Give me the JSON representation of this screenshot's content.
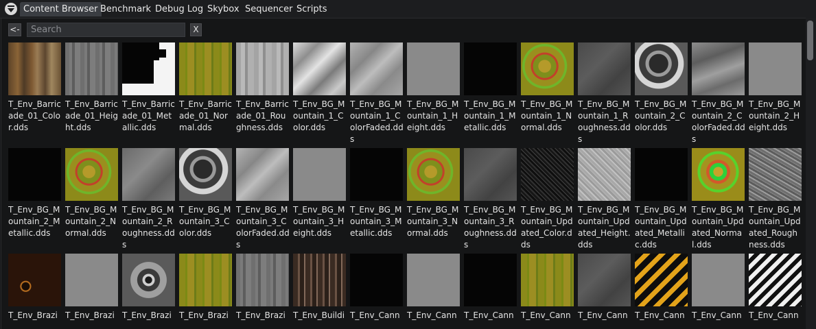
{
  "tabs": [
    {
      "label": "Content Browser",
      "active": true
    },
    {
      "label": "Benchmark",
      "active": false
    },
    {
      "label": "Debug Log",
      "active": false
    },
    {
      "label": "Skybox",
      "active": false
    },
    {
      "label": "Sequencer",
      "active": false
    },
    {
      "label": "Scripts",
      "active": false
    }
  ],
  "toolbar": {
    "back_label": "<-",
    "search_placeholder": "Search",
    "search_value": "",
    "clear_label": "X"
  },
  "icons": {
    "menu": "triangle-menu-icon"
  },
  "files": [
    {
      "label": "T_Env_Barricade_01_Color.dds",
      "thumb": "rust"
    },
    {
      "label": "T_Env_Barricade_01_Height.dds",
      "thumb": "graytex"
    },
    {
      "label": "T_Env_Barricade_01_Metallic.dds",
      "thumb": "bwmask"
    },
    {
      "label": "T_Env_Barricade_01_Normal.dds",
      "thumb": "normalflat"
    },
    {
      "label": "T_Env_Barricade_01_Roughness.dds",
      "thumb": "lightgray"
    },
    {
      "label": "T_Env_BG_Mountain_1_Color.dds",
      "thumb": "mountainlight"
    },
    {
      "label": "T_Env_BG_Mountain_1_ColorFaded.dds",
      "thumb": "mountainfaded"
    },
    {
      "label": "T_Env_BG_Mountain_1_Height.dds",
      "thumb": "flatgray"
    },
    {
      "label": "T_Env_BG_Mountain_1_Metallic.dds",
      "thumb": "black"
    },
    {
      "label": "T_Env_BG_Mountain_1_Normal.dds",
      "thumb": "normalmount"
    },
    {
      "label": "T_Env_BG_Mountain_1_Roughness.dds",
      "thumb": "darkgray"
    },
    {
      "label": "T_Env_BG_Mountain_2_Color.dds",
      "thumb": "mountaincontrast"
    },
    {
      "label": "T_Env_BG_Mountain_2_ColorFaded.dds",
      "thumb": "mountainfaded2"
    },
    {
      "label": "T_Env_BG_Mountain_2_Height.dds",
      "thumb": "flatgray"
    },
    {
      "label": "T_Env_BG_Mountain_2_Metallic.dds",
      "thumb": "black"
    },
    {
      "label": "T_Env_BG_Mountain_2_Normal.dds",
      "thumb": "normalmount"
    },
    {
      "label": "T_Env_BG_Mountain_2_Roughness.dds",
      "thumb": "midgray"
    },
    {
      "label": "T_Env_BG_Mountain_3_Color.dds",
      "thumb": "mountaincontrast"
    },
    {
      "label": "T_Env_BG_Mountain_3_ColorFaded.dds",
      "thumb": "mountainfaded"
    },
    {
      "label": "T_Env_BG_Mountain_3_Height.dds",
      "thumb": "flatgray"
    },
    {
      "label": "T_Env_BG_Mountain_3_Metallic.dds",
      "thumb": "black"
    },
    {
      "label": "T_Env_BG_Mountain_3_Normal.dds",
      "thumb": "normalmount"
    },
    {
      "label": "T_Env_BG_Mountain_3_Roughness.dds",
      "thumb": "darkgray"
    },
    {
      "label": "T_Env_BG_Mountain_Updated_Color.dds",
      "thumb": "darknoise"
    },
    {
      "label": "T_Env_BG_Mountain_Updated_Height.dds",
      "thumb": "lightnoise"
    },
    {
      "label": "T_Env_BG_Mountain_Updated_Metallic.dds",
      "thumb": "black"
    },
    {
      "label": "T_Env_BG_Mountain_Updated_Normal.dds",
      "thumb": "normalvivid"
    },
    {
      "label": "T_Env_BG_Mountain_Updated_Roughness.dds",
      "thumb": "graynoise"
    },
    {
      "label": "T_Env_Brazi",
      "thumb": "brazier"
    },
    {
      "label": "T_Env_Brazi",
      "thumb": "flatgray"
    },
    {
      "label": "T_Env_Brazi",
      "thumb": "gear"
    },
    {
      "label": "T_Env_Brazi",
      "thumb": "normalflat"
    },
    {
      "label": "T_Env_Brazi",
      "thumb": "graytex"
    },
    {
      "label": "T_Env_Buildi",
      "thumb": "wood"
    },
    {
      "label": "T_Env_Cann",
      "thumb": "black"
    },
    {
      "label": "T_Env_Cann",
      "thumb": "flatgray"
    },
    {
      "label": "T_Env_Cann",
      "thumb": "black"
    },
    {
      "label": "T_Env_Cann",
      "thumb": "normalflat"
    },
    {
      "label": "T_Env_Cann",
      "thumb": "darkgray"
    },
    {
      "label": "T_Env_Cann",
      "thumb": "hazard"
    },
    {
      "label": "T_Env_Cann",
      "thumb": "flatgray"
    },
    {
      "label": "T_Env_Cann",
      "thumb": "stripes"
    }
  ]
}
